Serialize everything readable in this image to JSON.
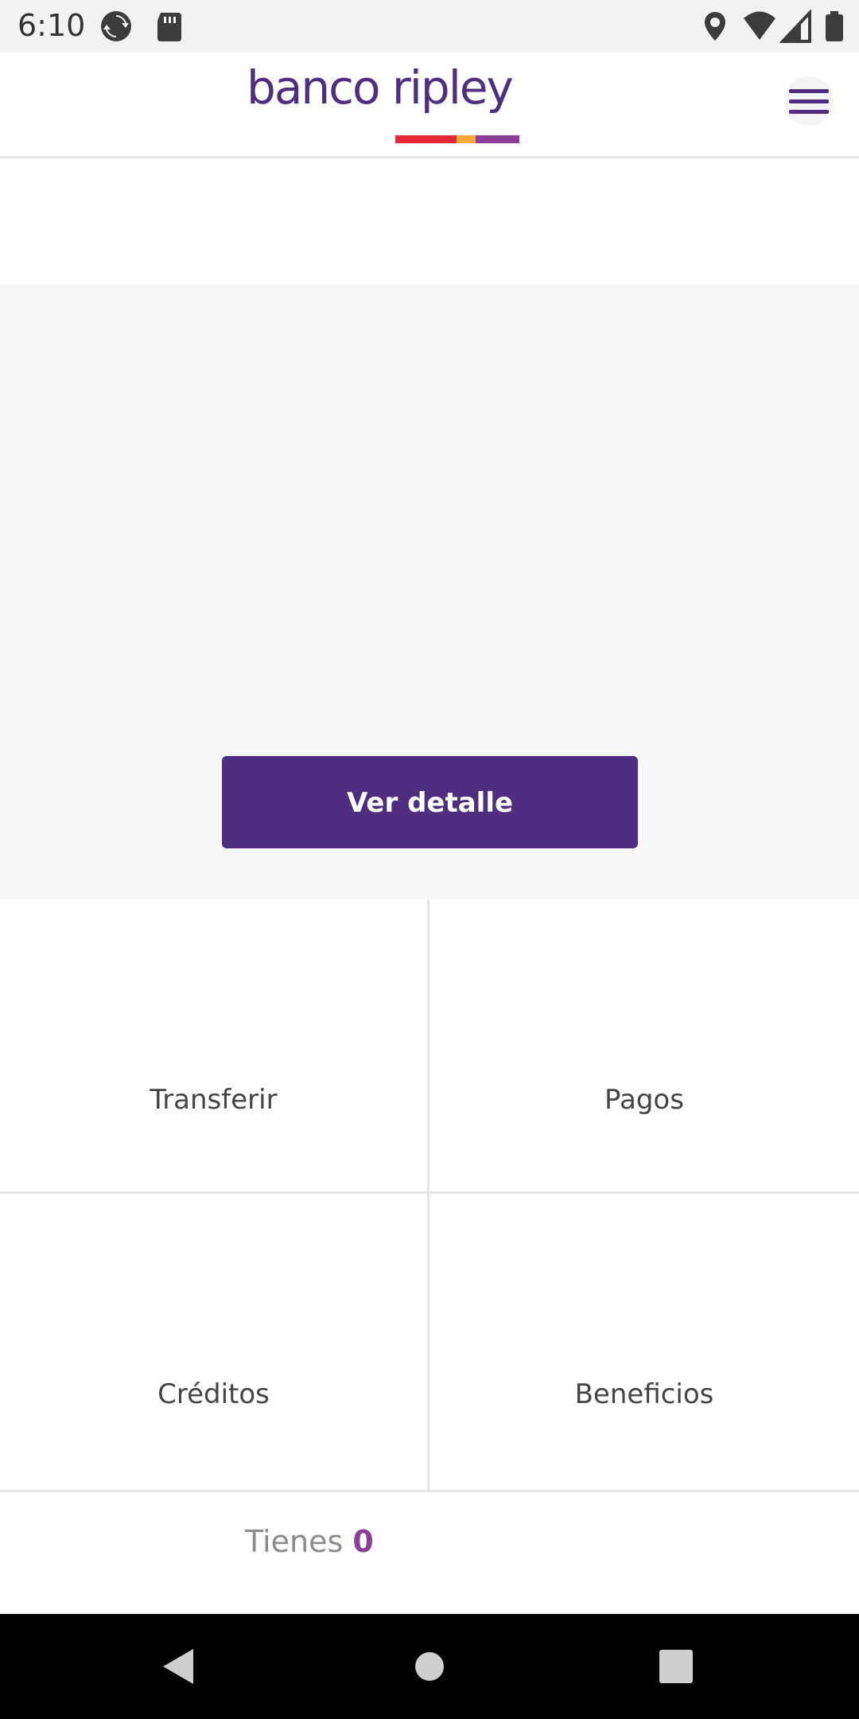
{
  "status_bar": {
    "time": "6:10",
    "icons": [
      "sync-icon",
      "sd-card-icon",
      "location-icon",
      "wifi-icon",
      "cell-signal-icon",
      "battery-icon"
    ]
  },
  "header": {
    "logo_text": "banco ripley",
    "menu_icon": "hamburger-menu-icon",
    "brand_colors": {
      "purple": "#4f2d7f",
      "red": "#e4293a",
      "orange": "#f5a93b",
      "violet": "#8b3f97"
    }
  },
  "hero": {
    "button_label": "Ver detalle"
  },
  "tiles": [
    {
      "label": "Transferir"
    },
    {
      "label": "Pagos"
    },
    {
      "label": "Créditos"
    },
    {
      "label": "Beneficios"
    }
  ],
  "summary": {
    "prefix": "Tienes",
    "count": "0"
  },
  "nav_bar": {
    "icons": [
      "back-icon",
      "home-icon",
      "recent-apps-icon"
    ]
  }
}
